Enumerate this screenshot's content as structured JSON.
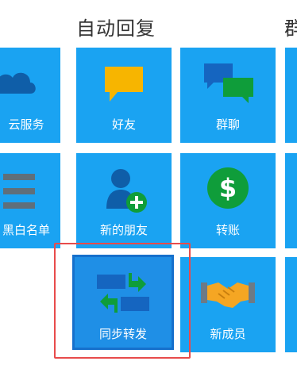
{
  "sections": {
    "auto_reply_title": "自动回复",
    "next_section_title_partial": "群"
  },
  "tiles": {
    "cloud_service": "云服务",
    "friends": "好友",
    "group_chat": "群聊",
    "blacklist": "黑白名单",
    "new_friends": "新的朋友",
    "transfer": "转账",
    "sync_forward": "同步转发",
    "new_members": "新成员"
  },
  "icons": {
    "cloud_service": "cloud-icon",
    "friends": "speech-bubble-icon",
    "group_chat": "group-chat-bubbles-icon",
    "blacklist": "list-icon",
    "new_friends": "add-user-icon",
    "transfer": "dollar-coin-icon",
    "sync_forward": "sync-arrows-icon",
    "new_members": "handshake-icon"
  },
  "colors": {
    "tile_bg": "#1aa3f2",
    "tile_selected_bg": "#1f8fe6",
    "highlight_border": "#e84b4b",
    "friends_bubble": "#f7b500",
    "group_bubble_blue": "#1565c0",
    "group_bubble_green": "#0f9d3a",
    "dollar_green": "#0f9d3a",
    "handshake_orange": "#f5a623"
  },
  "selected_tile": "同步转发"
}
